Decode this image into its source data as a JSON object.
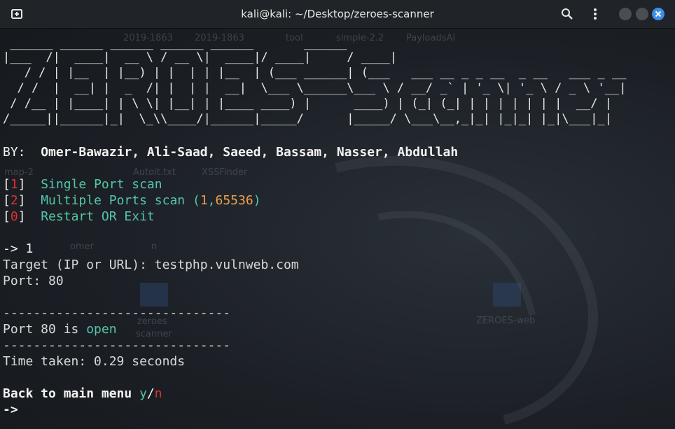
{
  "window": {
    "title": "kali@kali: ~/Desktop/zeroes-scanner"
  },
  "desktop_ghosts": [
    "2019-1863",
    "2019-1863",
    "tool",
    "simple-2.2",
    "PayloadsAl",
    "map-2",
    "Autoit.txt",
    "XSSFinder",
    "omer",
    "n",
    "zeroes",
    "scanner",
    "ZEROES-web"
  ],
  "terminal": {
    "banner": [
      " ______ ______ ______ ______ ______       ______",
      "|___  /|  ____|  __ \\ / __ \\|  ____|/ ____|     / ____|",
      "   / / | |__  | |__) | |  | | |__  | (___ ______| (___   ___ __ _ _ __  _ __   ___ _ __",
      "  / /  |  __| |  _  /| |  | |  __|  \\___ \\______\\___ \\ / __/ _` | '_ \\| '_ \\ / _ \\ '__|",
      " / /__ | |____| | \\ \\| |__| | |____ ____) |      ____) | (_| (_| | | | | | | |  __/ |",
      "/_____||______|_|  \\_\\\\____/|______|_____/      |_____/ \\___\\__,_|_| |_|_| |_|\\___|_|"
    ],
    "by_label": "BY:",
    "authors": "Omer-Bawazir, Ali-Saad, Saeed, Bassam, Nasser, Abdullah",
    "menu": [
      {
        "key": "1",
        "label": "Single Port scan"
      },
      {
        "key": "2",
        "label": "Multiple Ports scan",
        "range_open": " (",
        "range_start": "1",
        "range_sep": ",",
        "range_end": "65536",
        "range_close": ")"
      },
      {
        "key": "0",
        "label": "Restart OR Exit"
      }
    ],
    "prompt_input": "-> 1",
    "target_line": "Target (IP or URL): testphp.vulnweb.com",
    "port_line": "Port: 80",
    "separator": "------------------------------",
    "result_prefix": "Port 80 is ",
    "result_status": "open",
    "time_line": "Time taken: 0.29 seconds",
    "back_label": "Back to main menu ",
    "back_yes": "y",
    "back_slash": "/",
    "back_no": "n",
    "final_prompt": "->"
  }
}
